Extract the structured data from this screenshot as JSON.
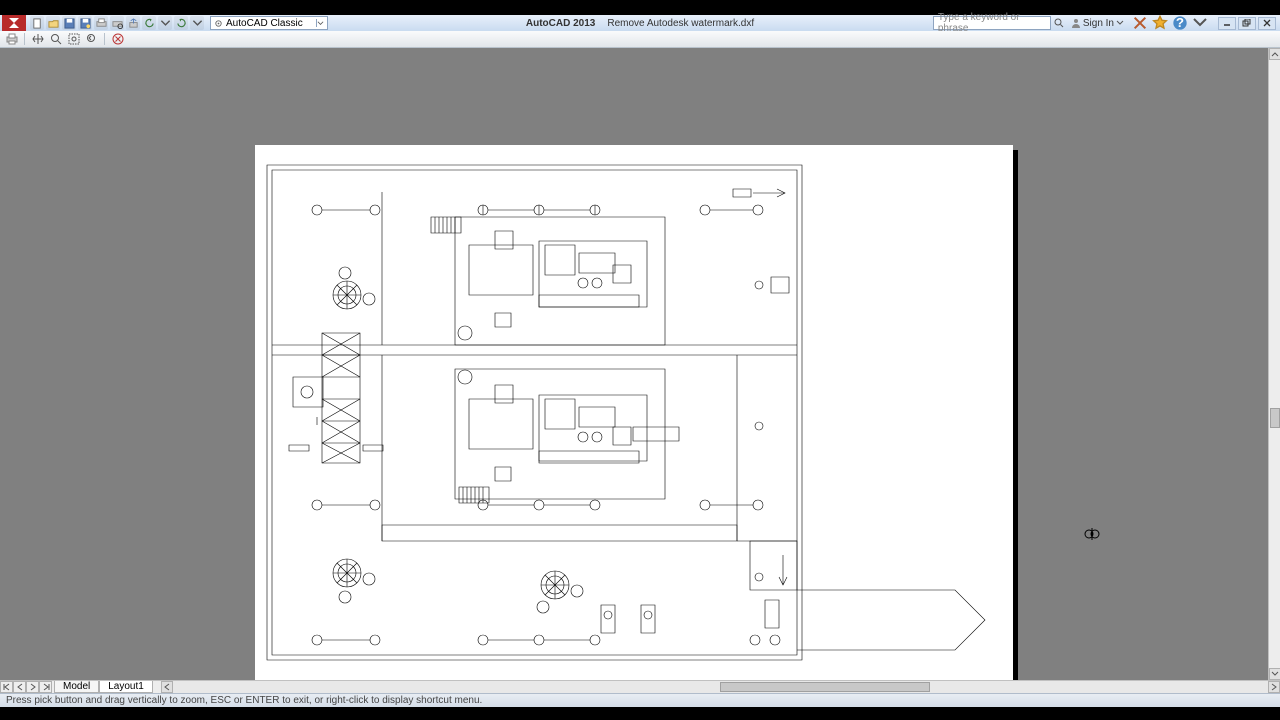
{
  "app": {
    "product": "AutoCAD 2013",
    "document": "Remove Autodesk watermark.dxf",
    "workspace": "AutoCAD Classic",
    "search_placeholder": "Type a keyword or phrase",
    "signin_label": "Sign In"
  },
  "tabs": {
    "model": "Model",
    "layout1": "Layout1"
  },
  "command_line": "Press pick button and drag vertically to zoom, ESC or ENTER to exit, or right-click to display shortcut menu.",
  "icons": {
    "new": "new-icon",
    "open": "open-icon",
    "save": "save-icon",
    "saveas": "saveas-icon",
    "plot": "plot-icon",
    "preview": "preview-icon",
    "publish": "publish-icon",
    "undo": "undo-icon",
    "redo": "redo-icon",
    "print": "print-icon",
    "pan": "pan-icon",
    "zoom": "zoom-icon",
    "zoom_window": "zoom-window-icon",
    "zoom_prev": "zoom-previous-icon",
    "close_preview": "close-preview-icon",
    "exchange": "exchange-icon",
    "star": "favorite-icon",
    "help": "help-icon",
    "chevron": "chevron-down-icon"
  }
}
